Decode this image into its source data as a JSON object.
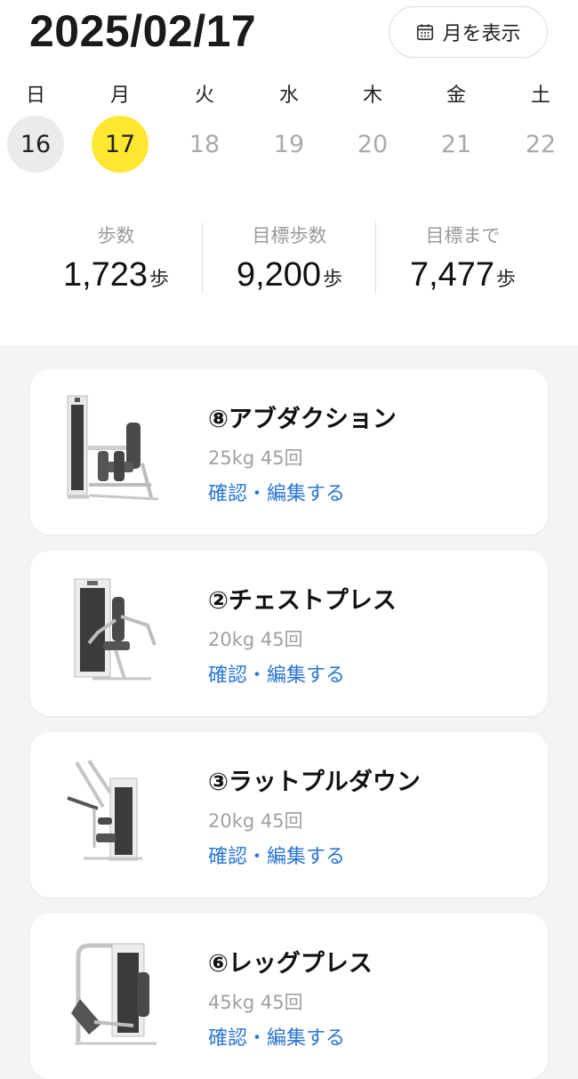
{
  "header": {
    "date": "2025/02/17",
    "month_button_label": "月を表示",
    "month_button_icon": "calendar-icon"
  },
  "week": [
    {
      "dow": "日",
      "day": "16",
      "state": "past"
    },
    {
      "dow": "月",
      "day": "17",
      "state": "today"
    },
    {
      "dow": "火",
      "day": "18",
      "state": "future"
    },
    {
      "dow": "水",
      "day": "19",
      "state": "future"
    },
    {
      "dow": "木",
      "day": "20",
      "state": "future"
    },
    {
      "dow": "金",
      "day": "21",
      "state": "future"
    },
    {
      "dow": "土",
      "day": "22",
      "state": "future"
    }
  ],
  "stats": [
    {
      "label": "歩数",
      "value": "1,723",
      "unit": "歩"
    },
    {
      "label": "目標歩数",
      "value": "9,200",
      "unit": "歩"
    },
    {
      "label": "目標まで",
      "value": "7,477",
      "unit": "歩"
    }
  ],
  "workouts": [
    {
      "title": "⑧アブダクション",
      "meta": "25kg 45回",
      "link": "確認・編集する",
      "machine_icon": "abduction-machine-icon"
    },
    {
      "title": "②チェストプレス",
      "meta": "20kg 45回",
      "link": "確認・編集する",
      "machine_icon": "chest-press-machine-icon"
    },
    {
      "title": "③ラットプルダウン",
      "meta": "20kg 45回",
      "link": "確認・編集する",
      "machine_icon": "lat-pulldown-machine-icon"
    },
    {
      "title": "⑥レッグプレス",
      "meta": "45kg 45回",
      "link": "確認・編集する",
      "machine_icon": "leg-press-machine-icon"
    }
  ],
  "colors": {
    "today_highlight": "#ffe631",
    "link": "#2a76d2",
    "page_background": "#f4f4f4"
  }
}
